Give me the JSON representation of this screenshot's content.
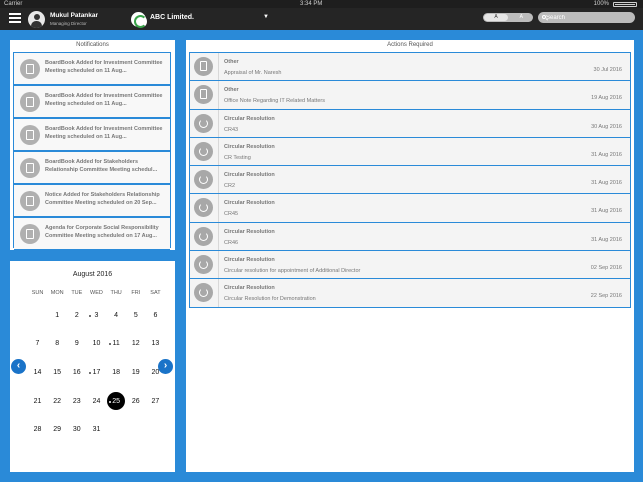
{
  "status_bar": {
    "carrier": "Carrier",
    "time": "3:34 PM",
    "battery": "100%"
  },
  "header": {
    "user_name": "Mukul Patankar",
    "user_role": "Managing Director",
    "company": "ABC Limited.",
    "company_dropdown": "▼",
    "font_toggle": {
      "active": "A",
      "inactive": "A"
    },
    "search_placeholder": "Search"
  },
  "notifications": {
    "title": "Notifications",
    "items": [
      {
        "text": "BoardBook Added for Investment Committee Meeting  scheduled on 11 Aug...",
        "icon": "book-icon"
      },
      {
        "text": "BoardBook Added for Investment Committee Meeting  scheduled on 11 Aug...",
        "icon": "book-icon"
      },
      {
        "text": "BoardBook Added for Investment Committee Meeting  scheduled on 11 Aug...",
        "icon": "book-icon"
      },
      {
        "text": "BoardBook Added for Stakeholders Relationship Committee Meeting  schedul...",
        "icon": "book-icon"
      },
      {
        "text": "Notice Added for Stakeholders Relationship Committee Meeting  scheduled on 20 Sep...",
        "icon": "notice-icon"
      },
      {
        "text": "Agenda for Corporate Social Responsibility Committee Meeting  scheduled on 17 Aug...",
        "icon": "book-icon"
      }
    ]
  },
  "calendar": {
    "month": "August 2016",
    "weekdays": [
      "SUN",
      "MON",
      "TUE",
      "WED",
      "THU",
      "FRI",
      "SAT"
    ],
    "prev": "‹",
    "next": "›",
    "weeks": [
      [
        "",
        "1",
        "2",
        "3",
        "4",
        "5",
        "6"
      ],
      [
        "7",
        "8",
        "9",
        "10",
        "11",
        "12",
        "13"
      ],
      [
        "14",
        "15",
        "16",
        "17",
        "18",
        "19",
        "20"
      ],
      [
        "21",
        "22",
        "23",
        "24",
        "25",
        "26",
        "27"
      ],
      [
        "28",
        "29",
        "30",
        "31",
        "",
        "",
        ""
      ]
    ],
    "event_days": [
      "3",
      "11",
      "17",
      "25"
    ],
    "today": "25"
  },
  "actions": {
    "title": "Actions Required",
    "items": [
      {
        "type": "Other",
        "description": "Appraisal of Mr. Naresh",
        "date": "30 Jul 2016",
        "icon": "document-icon"
      },
      {
        "type": "Other",
        "description": "Office Note Regarding IT Related Matters",
        "date": "19 Aug 2016",
        "icon": "document-icon"
      },
      {
        "type": "Circular Resolution",
        "description": "CR43",
        "date": "30 Aug 2016",
        "icon": "circular-icon"
      },
      {
        "type": "Circular Resolution",
        "description": "CR Testing",
        "date": "31 Aug 2016",
        "icon": "circular-icon"
      },
      {
        "type": "Circular Resolution",
        "description": "CR2",
        "date": "31 Aug 2016",
        "icon": "circular-icon"
      },
      {
        "type": "Circular Resolution",
        "description": "CR45",
        "date": "31 Aug 2016",
        "icon": "circular-icon"
      },
      {
        "type": "Circular Resolution",
        "description": "CR46",
        "date": "31 Aug 2016",
        "icon": "circular-icon"
      },
      {
        "type": "Circular Resolution",
        "description": "Circular resolution for appointment of Additional Director",
        "date": "02 Sep 2016",
        "icon": "circular-icon"
      },
      {
        "type": "Circular Resolution",
        "description": "Circular Resolution for Demonstration",
        "date": "22 Sep 2016",
        "icon": "circular-icon"
      }
    ]
  }
}
